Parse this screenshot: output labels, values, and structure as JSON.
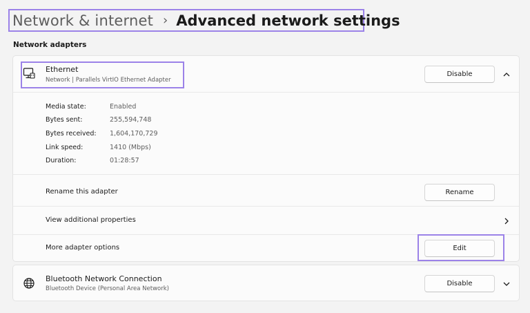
{
  "breadcrumb": {
    "parent": "Network & internet",
    "separator": "›",
    "current": "Advanced network settings"
  },
  "section_label": "Network adapters",
  "ethernet": {
    "name": "Ethernet",
    "description": "Network | Parallels VirtIO Ethernet Adapter",
    "disable_label": "Disable",
    "icon": "ethernet-monitor-icon",
    "expanded": true,
    "stats": [
      {
        "label": "Media state:",
        "value": "Enabled"
      },
      {
        "label": "Bytes sent:",
        "value": "255,594,748"
      },
      {
        "label": "Bytes received:",
        "value": "1,604,170,729"
      },
      {
        "label": "Link speed:",
        "value": "1410 (Mbps)"
      },
      {
        "label": "Duration:",
        "value": "01:28:57"
      }
    ],
    "options": {
      "rename": {
        "label": "Rename this adapter",
        "button": "Rename"
      },
      "properties": {
        "label": "View additional properties"
      },
      "more": {
        "label": "More adapter options",
        "button": "Edit"
      }
    }
  },
  "bluetooth": {
    "name": "Bluetooth Network Connection",
    "description": "Bluetooth Device (Personal Area Network)",
    "disable_label": "Disable",
    "icon": "globe-icon",
    "expanded": false
  },
  "colors": {
    "highlight": "#9b82e8",
    "background": "#f3f3f3",
    "card": "#fbfbfb"
  }
}
